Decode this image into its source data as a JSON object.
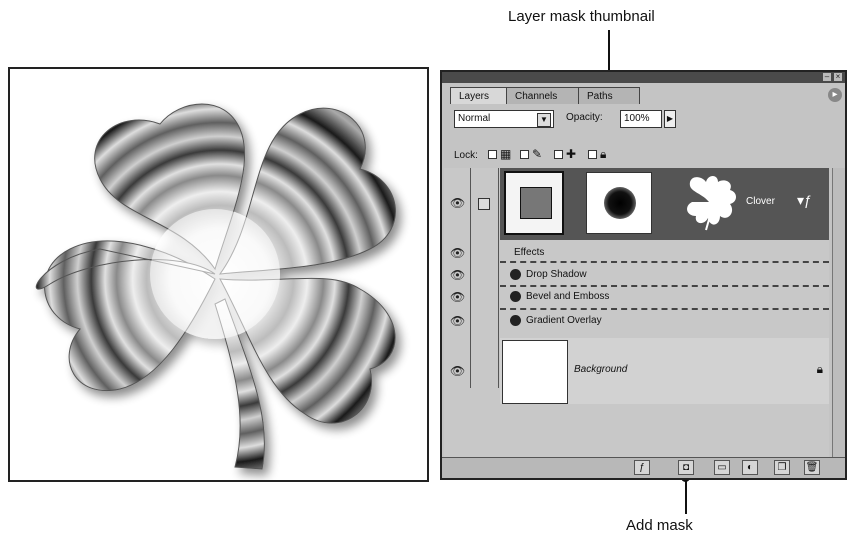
{
  "callouts": {
    "top": "Layer mask thumbnail",
    "bottom": "Add mask"
  },
  "palette": {
    "tabs": [
      "Layers",
      "Channels",
      "Paths"
    ],
    "blend_mode": "Normal",
    "opacity_label": "Opacity:",
    "opacity_value": "100%",
    "lock_label": "Lock:",
    "layers": {
      "clover_name": "Clover",
      "effects_label": "Effects",
      "effects": [
        "Drop Shadow",
        "Bevel and Emboss",
        "Gradient Overlay"
      ],
      "background_name": "Background"
    }
  },
  "colors": {
    "palette_bg": "#c4c4c4",
    "selected_row": "#555555"
  },
  "icons": [
    "eye-icon",
    "link-icon",
    "lock-icon",
    "fx-icon",
    "add-mask-icon",
    "new-layer-icon",
    "trash-icon"
  ]
}
